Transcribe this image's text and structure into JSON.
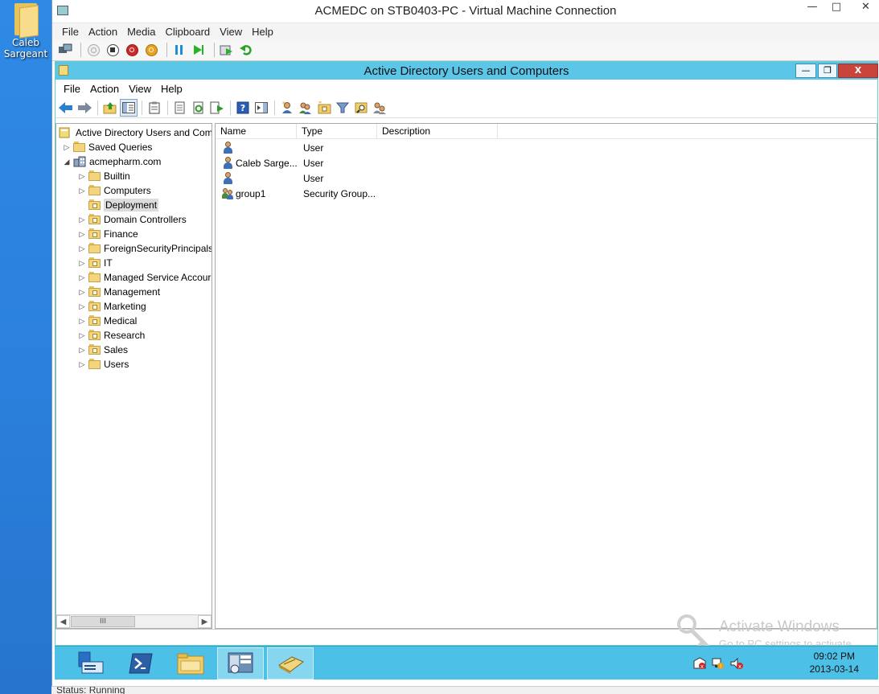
{
  "desktop": {
    "icon_label": "Caleb Sargeant"
  },
  "vm_window": {
    "title": "ACMEDC on STB0403-PC - Virtual Machine Connection",
    "menu": [
      "File",
      "Action",
      "Media",
      "Clipboard",
      "View",
      "Help"
    ],
    "toolbar_icons": [
      "ctrl-alt-del-icon",
      "start-icon",
      "turn-off-icon",
      "shut-down-icon",
      "save-icon",
      "pause-icon",
      "reset-icon",
      "snapshot-icon",
      "revert-icon"
    ],
    "status": "Status: Running"
  },
  "aduc": {
    "title": "Active Directory Users and Computers",
    "menu": [
      "File",
      "Action",
      "View",
      "Help"
    ],
    "tree": {
      "root": "Active Directory Users and Com",
      "saved_queries": "Saved Queries",
      "domain": "acmepharm.com",
      "items": [
        {
          "label": "Builtin",
          "type": "container"
        },
        {
          "label": "Computers",
          "type": "container"
        },
        {
          "label": "Deployment",
          "type": "ou",
          "selected": true
        },
        {
          "label": "Domain Controllers",
          "type": "ou"
        },
        {
          "label": "Finance",
          "type": "ou"
        },
        {
          "label": "ForeignSecurityPrincipals",
          "type": "container"
        },
        {
          "label": "IT",
          "type": "ou"
        },
        {
          "label": "Managed Service Accour",
          "type": "container"
        },
        {
          "label": "Management",
          "type": "ou"
        },
        {
          "label": "Marketing",
          "type": "ou"
        },
        {
          "label": "Medical",
          "type": "ou"
        },
        {
          "label": "Research",
          "type": "ou"
        },
        {
          "label": "Sales",
          "type": "ou"
        },
        {
          "label": "Users",
          "type": "container"
        }
      ],
      "scroll_thumb": "III"
    },
    "list": {
      "columns": [
        "Name",
        "Type",
        "Description"
      ],
      "rows": [
        {
          "name": "",
          "type": "User",
          "icon": "user-icon"
        },
        {
          "name": "Caleb Sarge...",
          "type": "User",
          "icon": "user-icon"
        },
        {
          "name": "",
          "type": "User",
          "icon": "user-icon"
        },
        {
          "name": "group1",
          "type": "Security Group...",
          "icon": "group-icon"
        }
      ]
    }
  },
  "watermark": {
    "line1": "Activate Windows",
    "line2": "Go to PC settings to activate"
  },
  "taskbar": {
    "clock_time": "09:02 PM",
    "clock_date": "2013-03-14"
  }
}
